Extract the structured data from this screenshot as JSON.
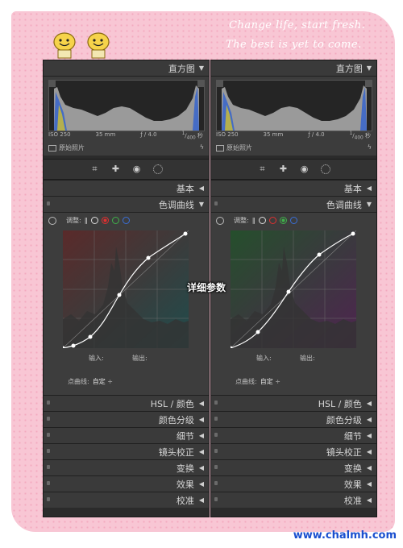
{
  "slogan": {
    "line1": "Change life, start fresh.",
    "line2": "The best is yet to come."
  },
  "watermark": "www.chalmh.com",
  "center_label": "详细参数",
  "panels": {
    "left": {
      "histogram_title": "直方图",
      "exif": {
        "iso": "ISO 250",
        "focal": "35 mm",
        "aperture": "ƒ / 4.0",
        "shutter_num": "1",
        "shutter_den": "400",
        "shutter_unit": "秒"
      },
      "original_photo": "原始照片",
      "basic": "基本",
      "tone_curve": "色调曲线",
      "adjust_label": "调整:",
      "input_label": "输入:",
      "output_label": "输出:",
      "point_curve_label": "点曲线:",
      "point_curve_value": "自定",
      "active_channel": "red",
      "sections": [
        "HSL / 颜色",
        "颜色分级",
        "细节",
        "镜头校正",
        "变换",
        "效果",
        "校准"
      ]
    },
    "right": {
      "histogram_title": "直方图",
      "exif": {
        "iso": "ISO 250",
        "focal": "35 mm",
        "aperture": "ƒ / 4.0",
        "shutter_num": "1",
        "shutter_den": "400",
        "shutter_unit": "秒"
      },
      "original_photo": "原始照片",
      "basic": "基本",
      "tone_curve": "色调曲线",
      "adjust_label": "调整:",
      "input_label": "输入:",
      "output_label": "输出:",
      "point_curve_label": "点曲线:",
      "point_curve_value": "自定",
      "active_channel": "green",
      "sections": [
        "HSL / 颜色",
        "颜色分级",
        "细节",
        "镜头校正",
        "变换",
        "效果",
        "校准"
      ]
    }
  },
  "colors": {
    "red_channel": "#e03030",
    "green_channel": "#3fb04a",
    "blue_channel": "#3a6fd8",
    "panel_bg": "#2b2b2b",
    "pink_bg": "#f8c6d4"
  }
}
